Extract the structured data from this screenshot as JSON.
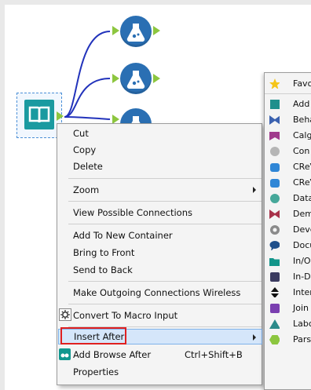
{
  "context_menu": {
    "items": [
      {
        "label": "Cut"
      },
      {
        "label": "Copy"
      },
      {
        "label": "Delete"
      },
      {
        "label": "Zoom"
      },
      {
        "label": "View Possible Connections"
      },
      {
        "label": "Add To New Container"
      },
      {
        "label": "Bring to Front"
      },
      {
        "label": "Send to Back"
      },
      {
        "label": "Make Outgoing Connections Wireless"
      },
      {
        "label": "Convert To Macro Input"
      },
      {
        "label": "Insert After"
      },
      {
        "label": "Add Browse After",
        "shortcut": "Ctrl+Shift+B"
      },
      {
        "label": "Properties"
      }
    ]
  },
  "submenu": {
    "items": [
      {
        "label": "Favo",
        "color": "#f5c518",
        "icon": "star-icon"
      },
      {
        "label": "Add",
        "color": "#1e8f8c",
        "icon": "burst-icon"
      },
      {
        "label": "Beha",
        "color": "#3b62b0",
        "icon": "bowtie-icon"
      },
      {
        "label": "Calg",
        "color": "#a03a8c",
        "icon": "banner-icon"
      },
      {
        "label": "Con",
        "color": "#b5b5b5",
        "icon": "gear-shape-icon"
      },
      {
        "label": "CReV",
        "color": "#2f86d6",
        "icon": "database-icon"
      },
      {
        "label": "CReV",
        "color": "#2f86d6",
        "icon": "database-icon"
      },
      {
        "label": "Data",
        "color": "#46a89a",
        "icon": "circle-icon"
      },
      {
        "label": "Dem",
        "color": "#a8324a",
        "icon": "bowtie-icon"
      },
      {
        "label": "Deve",
        "color": "#8a8a8a",
        "icon": "cog-icon"
      },
      {
        "label": "Docu",
        "color": "#1f4f8a",
        "icon": "chat-icon"
      },
      {
        "label": "In/O",
        "color": "#12958a",
        "icon": "folder-icon"
      },
      {
        "label": "In-D",
        "color": "#3b3b60",
        "icon": "database-icon"
      },
      {
        "label": "Inter",
        "color": "#111111",
        "icon": "up-down-icon"
      },
      {
        "label": "Join",
        "color": "#7a3fb0",
        "icon": "square-icon"
      },
      {
        "label": "Labc",
        "color": "#2c8a8a",
        "icon": "triangle-icon"
      },
      {
        "label": "Pars",
        "color": "#8cc63f",
        "icon": "hexagon-icon"
      }
    ]
  }
}
